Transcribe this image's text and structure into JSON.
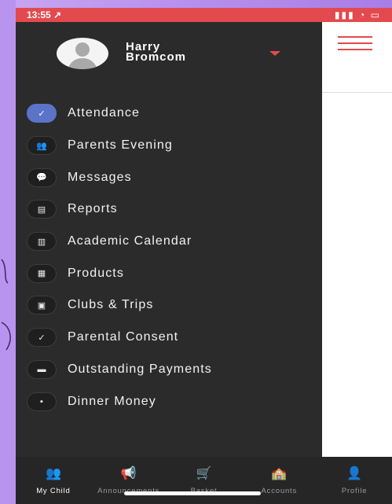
{
  "status_bar": {
    "time": "13:55 ↗",
    "indicators": "▮▮▮ ◔ ▭"
  },
  "profile": {
    "first_name": "Harry",
    "last_name": "Bromcom"
  },
  "menu": [
    {
      "label": "Attendance",
      "icon": "check-icon",
      "glyph": "✓",
      "active": true
    },
    {
      "label": "Parents Evening",
      "icon": "people-icon",
      "glyph": "👥",
      "active": false
    },
    {
      "label": "Messages",
      "icon": "chat-icon",
      "glyph": "💬",
      "active": false
    },
    {
      "label": "Reports",
      "icon": "report-icon",
      "glyph": "▤",
      "active": false
    },
    {
      "label": "Academic Calendar",
      "icon": "calendar-icon",
      "glyph": "▥",
      "active": false
    },
    {
      "label": "Products",
      "icon": "shop-icon",
      "glyph": "▦",
      "active": false
    },
    {
      "label": "Clubs & Trips",
      "icon": "bus-icon",
      "glyph": "▣",
      "active": false
    },
    {
      "label": "Parental Consent",
      "icon": "tick-icon",
      "glyph": "✓",
      "active": false
    },
    {
      "label": "Outstanding Payments",
      "icon": "card-icon",
      "glyph": "▬",
      "active": false
    },
    {
      "label": "Dinner Money",
      "icon": "wallet-icon",
      "glyph": "▪",
      "active": false
    }
  ],
  "tabs": [
    {
      "label": "My Child",
      "glyph": "👥",
      "active": true
    },
    {
      "label": "Announcements",
      "glyph": "📢",
      "active": false
    },
    {
      "label": "Basket",
      "glyph": "🛒",
      "active": false
    },
    {
      "label": "Accounts",
      "glyph": "🏫",
      "active": false
    },
    {
      "label": "Profile",
      "glyph": "👤",
      "active": false
    }
  ],
  "colors": {
    "accent": "#e24a4f",
    "active_item": "#5b74c8",
    "drawer_bg": "#2b2b2b"
  }
}
